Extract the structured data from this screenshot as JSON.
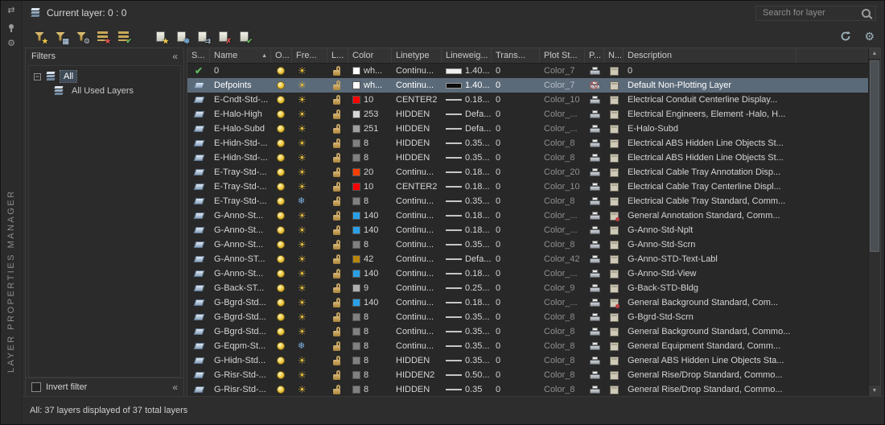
{
  "panel": {
    "title_vertical": "LAYER PROPERTIES MANAGER",
    "current_layer_label": "Current layer: 0 : 0",
    "search_placeholder": "Search for layer",
    "status_bar": "All: 37 layers displayed of 37 total layers"
  },
  "theme": {
    "selection_color": "#5b6a79",
    "panel_bg": "#2d2d2d",
    "grid_bg": "#282828",
    "sun_color": "#e2b93b",
    "freeze_color": "#7fb6e8",
    "check_color": "#5cb85c",
    "delete_color": "#d9534f"
  },
  "dock": {
    "autohide_glyph": "⇄",
    "menu_glyph": "⚙"
  },
  "toolbar": {
    "groups": [
      [
        {
          "id": "new-property-filter-icon",
          "base": "funnel",
          "overlay": "★",
          "overlay_color": "#ecc94b"
        },
        {
          "id": "new-group-filter-icon",
          "base": "funnel",
          "overlay": "▦",
          "overlay_color": "#9fb4c8"
        },
        {
          "id": "layer-states-manager-icon",
          "base": "funnel",
          "overlay": "⚙",
          "overlay_color": "#9aa5ad"
        },
        {
          "id": "layer-isolate-icon",
          "base": "stack",
          "overlay": "★",
          "overlay_color": "#d9534f"
        },
        {
          "id": "layer-unisolate-icon",
          "base": "stack",
          "overlay": "✔",
          "overlay_color": "#5cb85c"
        }
      ],
      [
        {
          "id": "new-layer-icon",
          "base": "sheet",
          "overlay": "★",
          "overlay_color": "#ecc94b"
        },
        {
          "id": "new-layer-vp-frozen-icon",
          "base": "sheet",
          "overlay": "❄",
          "overlay_color": "#7fb6e8"
        },
        {
          "id": "merge-layer-icon",
          "base": "sheet",
          "overlay": "⇉",
          "overlay_color": "#9fb4c8"
        },
        {
          "id": "delete-layer-icon",
          "base": "sheet",
          "overlay": "✗",
          "overlay_color": "#d9534f"
        },
        {
          "id": "set-current-layer-icon",
          "base": "sheet",
          "overlay": "✔",
          "overlay_color": "#5cb85c"
        }
      ]
    ],
    "settings_glyph": "⚙"
  },
  "filters": {
    "header": "Filters",
    "collapse_glyph": "«",
    "tree": [
      {
        "label": "All",
        "level": 0,
        "selected": true,
        "expand": "−"
      },
      {
        "label": "All Used Layers",
        "level": 1,
        "selected": false,
        "expand": ""
      }
    ],
    "invert_label": "Invert filter"
  },
  "scrollbar": {
    "up_glyph": "▲",
    "down_glyph": "▼"
  },
  "table": {
    "columns": [
      "S...",
      "Name",
      "O...",
      "Fre...",
      "L...",
      "Color",
      "Linetype",
      "Lineweig...",
      "Trans...",
      "Plot St...",
      "P...",
      "N...",
      "Description"
    ],
    "sort": {
      "column": "Name",
      "direction": "asc",
      "glyph": "▲"
    },
    "rows": [
      {
        "status": "current",
        "name": "0",
        "on": true,
        "freeze": "thaw",
        "lock": "unlocked",
        "color": "wh...",
        "color_hex": "#FFFFFF",
        "linetype": "Continu...",
        "lineweight": "1.40...",
        "lw_glyph": "thickL",
        "transparency": "0",
        "plot_style": "Color_7",
        "plot": true,
        "new_vp": "normal",
        "description": "0",
        "selected": false
      },
      {
        "status": "normal",
        "name": "Defpoints",
        "on": true,
        "freeze": "thaw",
        "lock": "unlocked",
        "color": "wh...",
        "color_hex": "#FFFFFF",
        "linetype": "Continu...",
        "lineweight": "1.40...",
        "lw_glyph": "thickD",
        "transparency": "0",
        "plot_style": "Color_7",
        "plot": false,
        "new_vp": "normal",
        "description": "Default Non-Plotting Layer",
        "selected": true
      },
      {
        "status": "normal",
        "name": "E-Cndt-Std-...",
        "on": true,
        "freeze": "thaw",
        "lock": "unlocked",
        "color": "10",
        "color_hex": "#FF0000",
        "linetype": "CENTER2",
        "lineweight": "0.18...",
        "lw_glyph": "thin",
        "transparency": "0",
        "plot_style": "Color_10",
        "plot": true,
        "new_vp": "normal",
        "description": "Electrical Conduit Centerline Display...",
        "selected": false
      },
      {
        "status": "normal",
        "name": "E-Halo-High",
        "on": true,
        "freeze": "thaw",
        "lock": "unlocked",
        "color": "253",
        "color_hex": "#D6D6D6",
        "linetype": "HIDDEN",
        "lineweight": "Defa...",
        "lw_glyph": "thin",
        "transparency": "0",
        "plot_style": "Color_...",
        "plot": true,
        "new_vp": "normal",
        "description": "Electrical Engineers, Element -Halo, H...",
        "selected": false
      },
      {
        "status": "normal",
        "name": "E-Halo-Subd",
        "on": true,
        "freeze": "thaw",
        "lock": "unlocked",
        "color": "251",
        "color_hex": "#A0A0A0",
        "linetype": "HIDDEN",
        "lineweight": "Defa...",
        "lw_glyph": "thin",
        "transparency": "0",
        "plot_style": "Color_...",
        "plot": true,
        "new_vp": "normal",
        "description": "E-Halo-Subd",
        "selected": false
      },
      {
        "status": "normal",
        "name": "E-Hidn-Std-...",
        "on": true,
        "freeze": "thaw",
        "lock": "unlocked",
        "color": "8",
        "color_hex": "#808080",
        "linetype": "HIDDEN",
        "lineweight": "0.35...",
        "lw_glyph": "thin",
        "transparency": "0",
        "plot_style": "Color_8",
        "plot": true,
        "new_vp": "normal",
        "description": "Electrical ABS Hidden Line Objects St...",
        "selected": false
      },
      {
        "status": "normal",
        "name": "E-Hidn-Std-...",
        "on": true,
        "freeze": "thaw",
        "lock": "unlocked",
        "color": "8",
        "color_hex": "#808080",
        "linetype": "HIDDEN",
        "lineweight": "0.35...",
        "lw_glyph": "thin",
        "transparency": "0",
        "plot_style": "Color_8",
        "plot": true,
        "new_vp": "normal",
        "description": "Electrical ABS Hidden Line Objects St...",
        "selected": false
      },
      {
        "status": "normal",
        "name": "E-Tray-Std-...",
        "on": true,
        "freeze": "thaw",
        "lock": "unlocked",
        "color": "20",
        "color_hex": "#FF3F00",
        "linetype": "Continu...",
        "lineweight": "0.18...",
        "lw_glyph": "thin",
        "transparency": "0",
        "plot_style": "Color_20",
        "plot": true,
        "new_vp": "normal",
        "description": "Electrical Cable Tray Annotation Disp...",
        "selected": false
      },
      {
        "status": "normal",
        "name": "E-Tray-Std-...",
        "on": true,
        "freeze": "thaw",
        "lock": "unlocked",
        "color": "10",
        "color_hex": "#FF0000",
        "linetype": "CENTER2",
        "lineweight": "0.18...",
        "lw_glyph": "thin",
        "transparency": "0",
        "plot_style": "Color_10",
        "plot": true,
        "new_vp": "normal",
        "description": "Electrical Cable Tray Centerline Displ...",
        "selected": false
      },
      {
        "status": "normal",
        "name": "E-Tray-Std-...",
        "on": true,
        "freeze": "frozen",
        "lock": "unlocked",
        "color": "8",
        "color_hex": "#808080",
        "linetype": "Continu...",
        "lineweight": "0.35...",
        "lw_glyph": "thin",
        "transparency": "0",
        "plot_style": "Color_8",
        "plot": true,
        "new_vp": "normal",
        "description": "Electrical Cable Tray Standard, Comm...",
        "selected": false
      },
      {
        "status": "normal",
        "name": "G-Anno-St...",
        "on": true,
        "freeze": "thaw",
        "lock": "unlocked",
        "color": "140",
        "color_hex": "#29A0E6",
        "linetype": "Continu...",
        "lineweight": "0.18...",
        "lw_glyph": "thin",
        "transparency": "0",
        "plot_style": "Color_...",
        "plot": true,
        "new_vp": "marked",
        "description": "General Annotation Standard, Comm...",
        "selected": false
      },
      {
        "status": "normal",
        "name": "G-Anno-St...",
        "on": true,
        "freeze": "thaw",
        "lock": "unlocked",
        "color": "140",
        "color_hex": "#29A0E6",
        "linetype": "Continu...",
        "lineweight": "0.18...",
        "lw_glyph": "thin",
        "transparency": "0",
        "plot_style": "Color_...",
        "plot": true,
        "new_vp": "normal",
        "description": "G-Anno-Std-Nplt",
        "selected": false
      },
      {
        "status": "normal",
        "name": "G-Anno-St...",
        "on": true,
        "freeze": "thaw",
        "lock": "unlocked",
        "color": "8",
        "color_hex": "#808080",
        "linetype": "Continu...",
        "lineweight": "0.35...",
        "lw_glyph": "thin",
        "transparency": "0",
        "plot_style": "Color_8",
        "plot": true,
        "new_vp": "normal",
        "description": "G-Anno-Std-Scrn",
        "selected": false
      },
      {
        "status": "normal",
        "name": "G-Anno-ST...",
        "on": true,
        "freeze": "thaw",
        "lock": "unlocked",
        "color": "42",
        "color_hex": "#B8860B",
        "linetype": "Continu...",
        "lineweight": "Defa...",
        "lw_glyph": "thin",
        "transparency": "0",
        "plot_style": "Color_42",
        "plot": true,
        "new_vp": "normal",
        "description": "G-Anno-STD-Text-Labl",
        "selected": false
      },
      {
        "status": "normal",
        "name": "G-Anno-St...",
        "on": true,
        "freeze": "thaw",
        "lock": "unlocked",
        "color": "140",
        "color_hex": "#29A0E6",
        "linetype": "Continu...",
        "lineweight": "0.18...",
        "lw_glyph": "thin",
        "transparency": "0",
        "plot_style": "Color_...",
        "plot": true,
        "new_vp": "normal",
        "description": "G-Anno-Std-View",
        "selected": false
      },
      {
        "status": "normal",
        "name": "G-Back-ST...",
        "on": true,
        "freeze": "thaw",
        "lock": "unlocked",
        "color": "9",
        "color_hex": "#B0B0B0",
        "linetype": "Continu...",
        "lineweight": "0.25...",
        "lw_glyph": "thin",
        "transparency": "0",
        "plot_style": "Color_9",
        "plot": true,
        "new_vp": "normal",
        "description": "G-Back-STD-Bldg",
        "selected": false
      },
      {
        "status": "normal",
        "name": "G-Bgrd-Std...",
        "on": true,
        "freeze": "thaw",
        "lock": "unlocked",
        "color": "140",
        "color_hex": "#29A0E6",
        "linetype": "Continu...",
        "lineweight": "0.18...",
        "lw_glyph": "thin",
        "transparency": "0",
        "plot_style": "Color_...",
        "plot": true,
        "new_vp": "marked",
        "description": "General Background Standard, Com...",
        "selected": false
      },
      {
        "status": "normal",
        "name": "G-Bgrd-Std...",
        "on": true,
        "freeze": "thaw",
        "lock": "unlocked",
        "color": "8",
        "color_hex": "#808080",
        "linetype": "Continu...",
        "lineweight": "0.35...",
        "lw_glyph": "thin",
        "transparency": "0",
        "plot_style": "Color_8",
        "plot": true,
        "new_vp": "normal",
        "description": "G-Bgrd-Std-Scrn",
        "selected": false
      },
      {
        "status": "normal",
        "name": "G-Bgrd-Std...",
        "on": true,
        "freeze": "thaw",
        "lock": "unlocked",
        "color": "8",
        "color_hex": "#808080",
        "linetype": "Continu...",
        "lineweight": "0.35...",
        "lw_glyph": "thin",
        "transparency": "0",
        "plot_style": "Color_8",
        "plot": true,
        "new_vp": "normal",
        "description": "General Background Standard, Commo...",
        "selected": false
      },
      {
        "status": "normal",
        "name": "G-Eqpm-St...",
        "on": true,
        "freeze": "frozen",
        "lock": "unlocked",
        "color": "8",
        "color_hex": "#808080",
        "linetype": "Continu...",
        "lineweight": "0.35...",
        "lw_glyph": "thin",
        "transparency": "0",
        "plot_style": "Color_8",
        "plot": true,
        "new_vp": "normal",
        "description": "General Equipment Standard, Comm...",
        "selected": false
      },
      {
        "status": "normal",
        "name": "G-Hidn-Std...",
        "on": true,
        "freeze": "thaw",
        "lock": "unlocked",
        "color": "8",
        "color_hex": "#808080",
        "linetype": "HIDDEN",
        "lineweight": "0.35...",
        "lw_glyph": "thin",
        "transparency": "0",
        "plot_style": "Color_8",
        "plot": true,
        "new_vp": "normal",
        "description": "General ABS Hidden Line Objects Sta...",
        "selected": false
      },
      {
        "status": "normal",
        "name": "G-Risr-Std-...",
        "on": true,
        "freeze": "thaw",
        "lock": "unlocked",
        "color": "8",
        "color_hex": "#808080",
        "linetype": "HIDDEN2",
        "lineweight": "0.50...",
        "lw_glyph": "thin",
        "transparency": "0",
        "plot_style": "Color_8",
        "plot": true,
        "new_vp": "normal",
        "description": "General Rise/Drop Standard, Commo...",
        "selected": false
      },
      {
        "status": "normal",
        "name": "G-Risr-Std-...",
        "on": true,
        "freeze": "thaw",
        "lock": "unlocked",
        "color": "8",
        "color_hex": "#808080",
        "linetype": "HIDDEN",
        "lineweight": "0.35",
        "lw_glyph": "thin",
        "transparency": "0",
        "plot_style": "Color_8",
        "plot": true,
        "new_vp": "normal",
        "description": "General Rise/Drop Standard, Commo...",
        "selected": false
      }
    ]
  }
}
